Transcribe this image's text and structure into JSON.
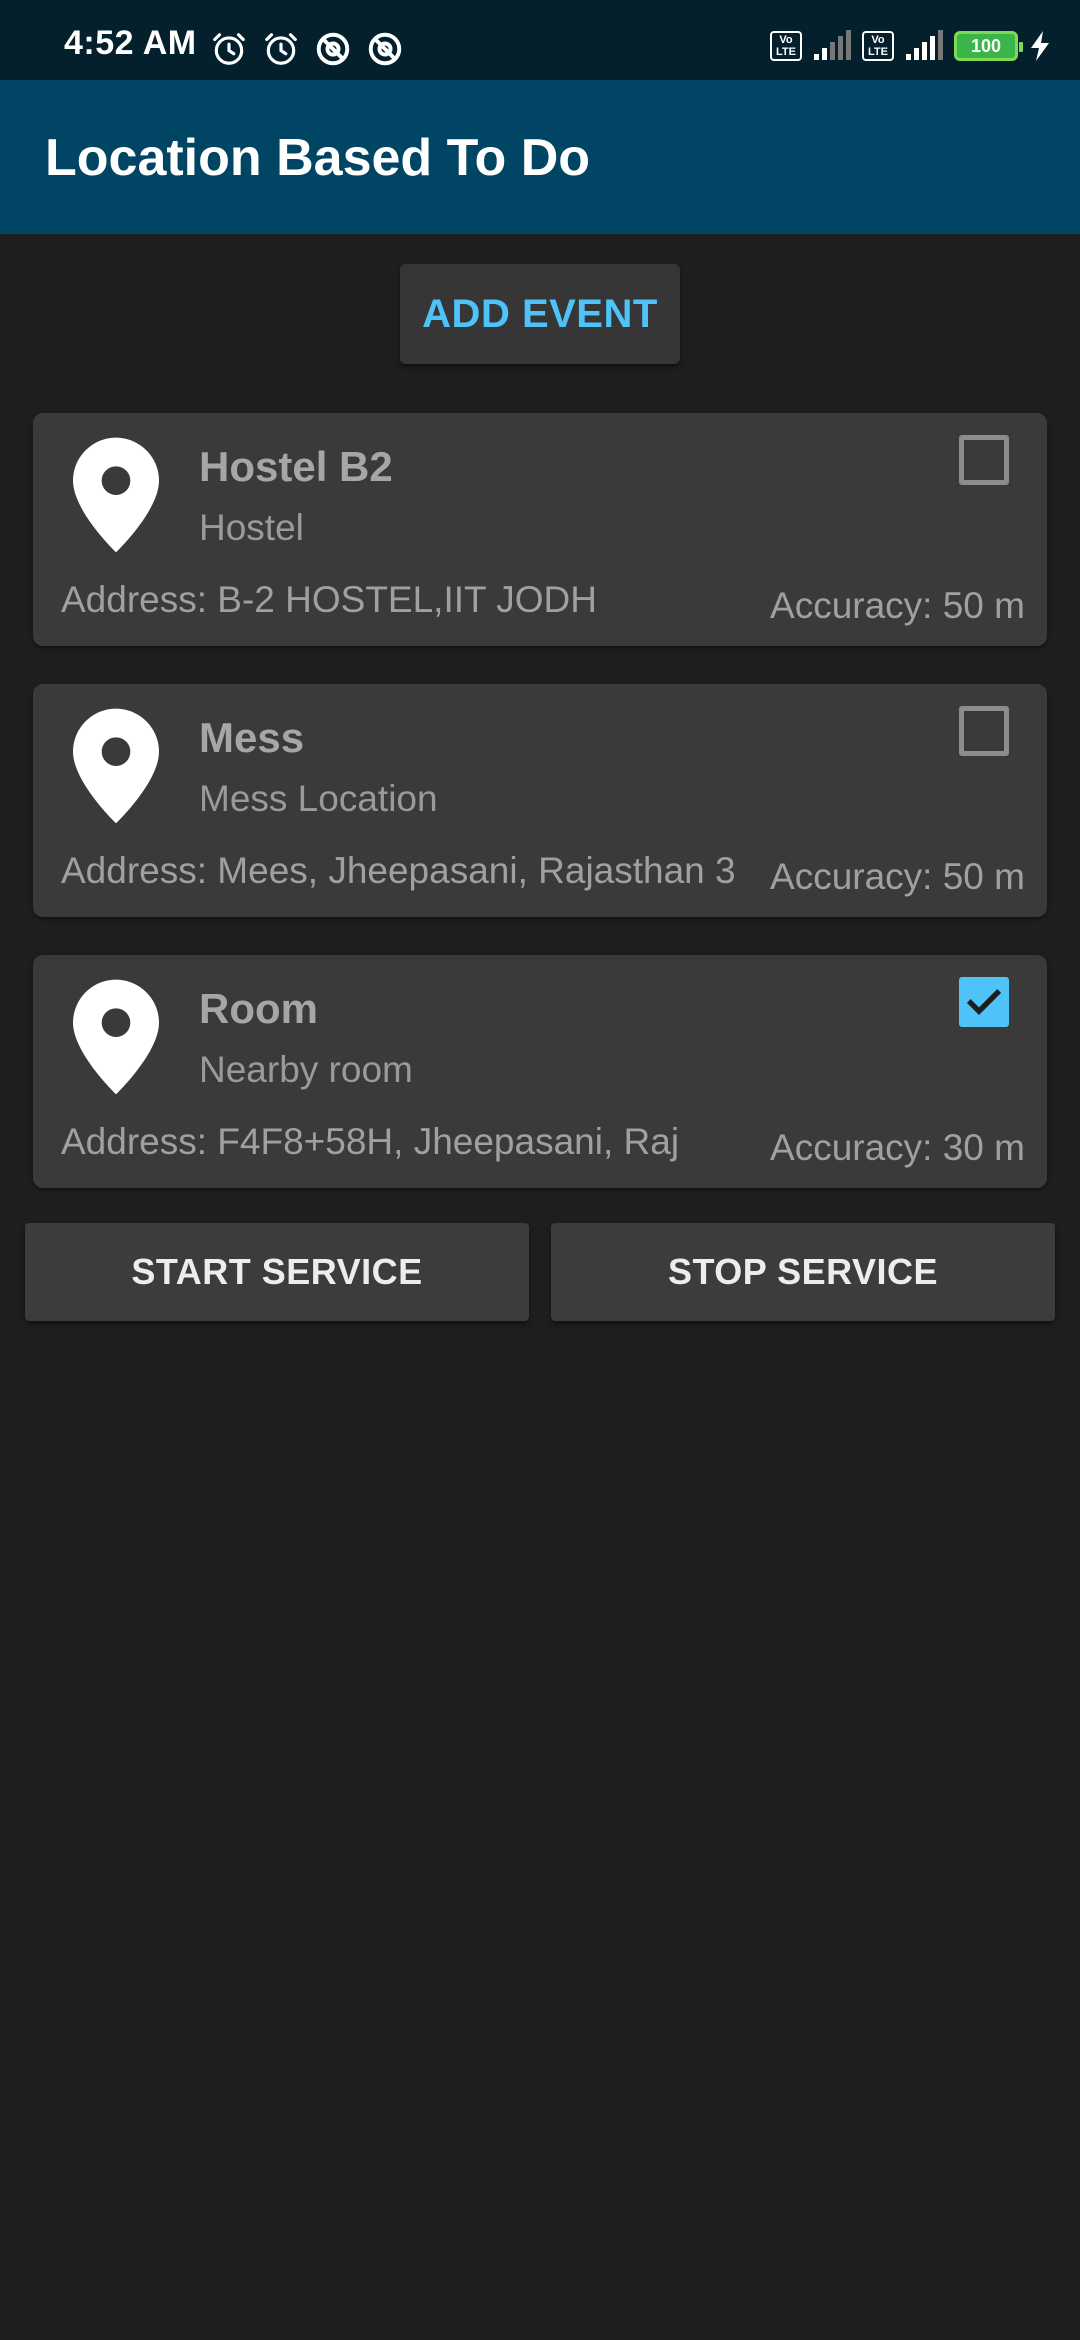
{
  "status_bar": {
    "time": "4:52 AM",
    "left_icons": [
      "alarm-icon",
      "alarm-icon",
      "data-saver-icon",
      "data-saver-icon"
    ],
    "sim1_badge": "Vo LTE",
    "sim2_badge": "Vo LTE",
    "battery_level": "100",
    "battery_color": "#39b54a"
  },
  "app_bar": {
    "title": "Location Based To Do",
    "color": "#004563"
  },
  "add_event": {
    "label": "ADD EVENT",
    "accent_color": "#4fc3f7"
  },
  "events": [
    {
      "name": "Hostel B2",
      "description": "Hostel",
      "address": "Address: B-2 HOSTEL,IIT JODH",
      "accuracy": "Accuracy: 50 m",
      "checked": false
    },
    {
      "name": "Mess",
      "description": "Mess Location",
      "address": "Address: Mees, Jheepasani, Rajasthan 3",
      "accuracy": "Accuracy: 50 m",
      "checked": false
    },
    {
      "name": "Room",
      "description": "Nearby room",
      "address": "Address: F4F8+58H, Jheepasani, Raj",
      "accuracy": "Accuracy: 30 m",
      "checked": true
    }
  ],
  "services": {
    "start_label": "START SERVICE",
    "stop_label": "STOP SERVICE"
  }
}
